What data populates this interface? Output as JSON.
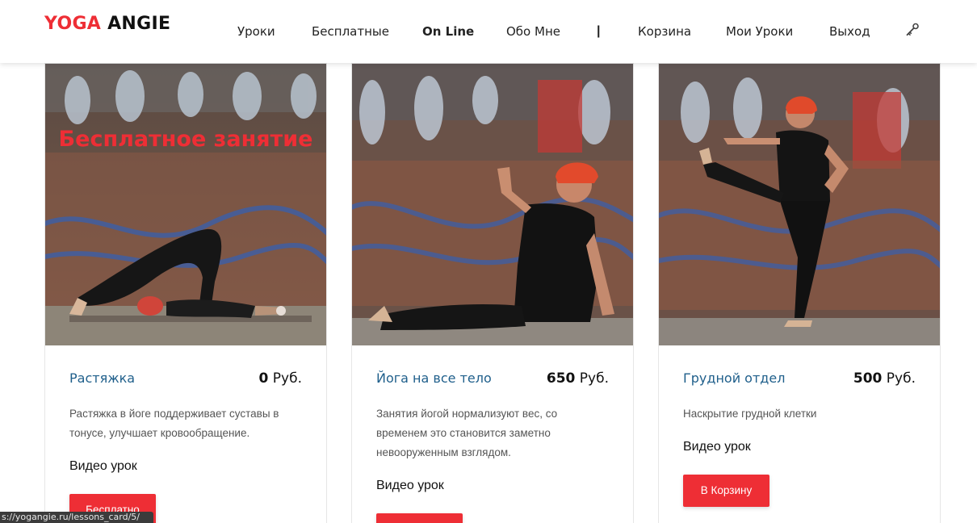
{
  "brand": {
    "part1": "YOGA",
    "part2": "ANGIE",
    "accent": "#ee2e35"
  },
  "nav": {
    "items": [
      {
        "label": "Уроки"
      },
      {
        "label": "Бесплатные"
      },
      {
        "label": "On Line"
      },
      {
        "label": "Обо Мне"
      },
      {
        "label": "|"
      },
      {
        "label": "Корзина"
      },
      {
        "label": "Мои Уроки"
      },
      {
        "label": "Выход"
      }
    ],
    "key_icon": "key-icon"
  },
  "cards": [
    {
      "overlay_text": "Бесплатное занятие",
      "title": "Растяжка",
      "price_value": "0",
      "price_currency": "Руб.",
      "description": "Растяжка в йоге поддерживает суставы в тонусе, улучшает кровообращение.",
      "type": "Видео урок",
      "button": "Бесплатно"
    },
    {
      "overlay_text": "",
      "title": "Йога на все тело",
      "price_value": "650",
      "price_currency": "Руб.",
      "description": "Занятия йогой нормализуют вес, со временем это становится заметно невооруженным взглядом.",
      "type": "Видео урок",
      "button": ""
    },
    {
      "overlay_text": "",
      "title": "Грудной отдел",
      "price_value": "500",
      "price_currency": "Руб.",
      "description": "Наскрытие грудной клетки",
      "type": "Видео урок",
      "button": "В Корзину"
    }
  ],
  "status_bar": {
    "url": "s://yogangie.ru/lessons_card/5/"
  }
}
